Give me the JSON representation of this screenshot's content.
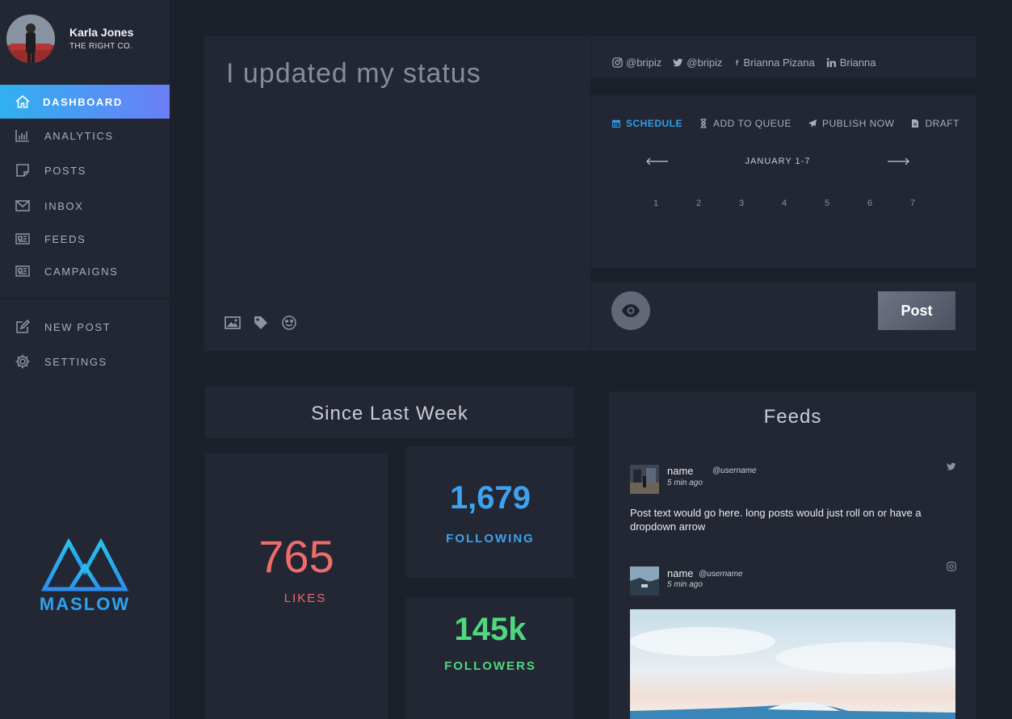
{
  "profile": {
    "name": "Karla Jones",
    "company": "THE RIGHT CO."
  },
  "nav": {
    "items": [
      {
        "label": "DASHBOARD",
        "icon": "home-icon",
        "active": true
      },
      {
        "label": "ANALYTICS",
        "icon": "bar-chart-icon"
      },
      {
        "label": "POSTS",
        "icon": "note-icon"
      },
      {
        "label": "INBOX",
        "icon": "envelope-icon"
      },
      {
        "label": "FEEDS",
        "icon": "newspaper-icon"
      },
      {
        "label": "CAMPAIGNS",
        "icon": "newspaper-icon"
      }
    ],
    "secondary": [
      {
        "label": "NEW POST",
        "icon": "edit-icon"
      },
      {
        "label": "SETTINGS",
        "icon": "gear-icon"
      }
    ]
  },
  "brand": {
    "name": "MASLOW",
    "color": "#2aa3ef"
  },
  "composer": {
    "text": "I updated my status"
  },
  "social": {
    "instagram": "@bripiz",
    "twitter": "@bripiz",
    "facebook": "Brianna Pizana",
    "linkedin": "Brianna"
  },
  "schedule": {
    "tabs": [
      {
        "label": "SCHEDULE",
        "icon": "calendar-icon",
        "active": true
      },
      {
        "label": "ADD TO QUEUE",
        "icon": "hourglass-icon"
      },
      {
        "label": "PUBLISH NOW",
        "icon": "paper-plane-icon"
      },
      {
        "label": "DRAFT",
        "icon": "file-icon"
      }
    ],
    "week_label": "JANUARY 1-7",
    "days": [
      "1",
      "2",
      "3",
      "4",
      "5",
      "6",
      "7"
    ]
  },
  "actions": {
    "post_label": "Post"
  },
  "stats": {
    "title": "Since Last Week",
    "likes_value": "765",
    "likes_label": "LIKES",
    "following_value": "1,679",
    "following_label": "FOLLOWING",
    "followers_value": "145k",
    "followers_label": "FOLLOWERS",
    "colors": {
      "likes": "#f06b6b",
      "following": "#3ea2f0",
      "followers": "#4fd87f"
    }
  },
  "feeds": {
    "title": "Feeds",
    "posts": [
      {
        "name": "name",
        "username": "@username",
        "time": "5 min ago",
        "text": "Post text would go here. long posts would just roll on or have a dropdown arrow",
        "network": "twitter-icon"
      },
      {
        "name": "name",
        "username": "@username",
        "time": "5 min ago",
        "network": "instagram-icon"
      }
    ]
  }
}
